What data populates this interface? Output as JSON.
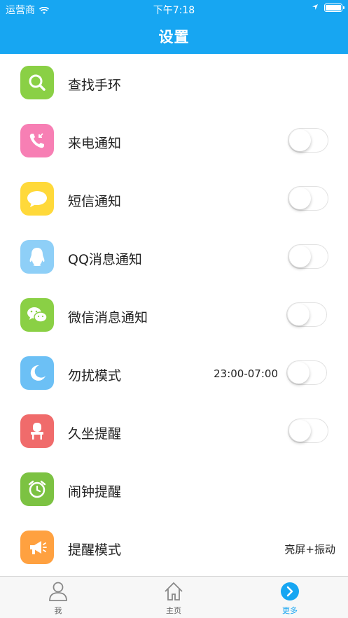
{
  "status_bar": {
    "carrier": "运营商",
    "time": "下午7:18",
    "battery_level": 1.0
  },
  "header": {
    "title": "设置"
  },
  "colors": {
    "accent": "#17a6f2",
    "search": "#8ad045",
    "call": "#f77fb4",
    "sms": "#ffd93a",
    "qq": "#8ecff7",
    "wechat": "#8ad045",
    "dnd": "#6cc0f5",
    "sedentary": "#f06b6b",
    "alarm": "#7cc242",
    "remind": "#ffa140"
  },
  "settings": {
    "items": [
      {
        "label": "查找手环",
        "icon": "search-icon"
      },
      {
        "label": "来电通知",
        "icon": "phone-icon",
        "toggle": false
      },
      {
        "label": "短信通知",
        "icon": "message-icon",
        "toggle": false
      },
      {
        "label": "QQ消息通知",
        "icon": "qq-icon",
        "toggle": false
      },
      {
        "label": "微信消息通知",
        "icon": "wechat-icon",
        "toggle": false
      },
      {
        "label": "勿扰模式",
        "icon": "moon-icon",
        "value": "23:00-07:00",
        "toggle": false
      },
      {
        "label": "久坐提醒",
        "icon": "chair-icon",
        "toggle": false
      },
      {
        "label": "闹钟提醒",
        "icon": "alarm-clock-icon"
      },
      {
        "label": "提醒模式",
        "icon": "megaphone-icon",
        "value": "亮屏+振动"
      }
    ]
  },
  "tabbar": {
    "tabs": [
      {
        "label": "我",
        "icon": "person-icon"
      },
      {
        "label": "主页",
        "icon": "home-icon"
      },
      {
        "label": "更多",
        "icon": "more-arrow-icon",
        "active": true
      }
    ]
  }
}
